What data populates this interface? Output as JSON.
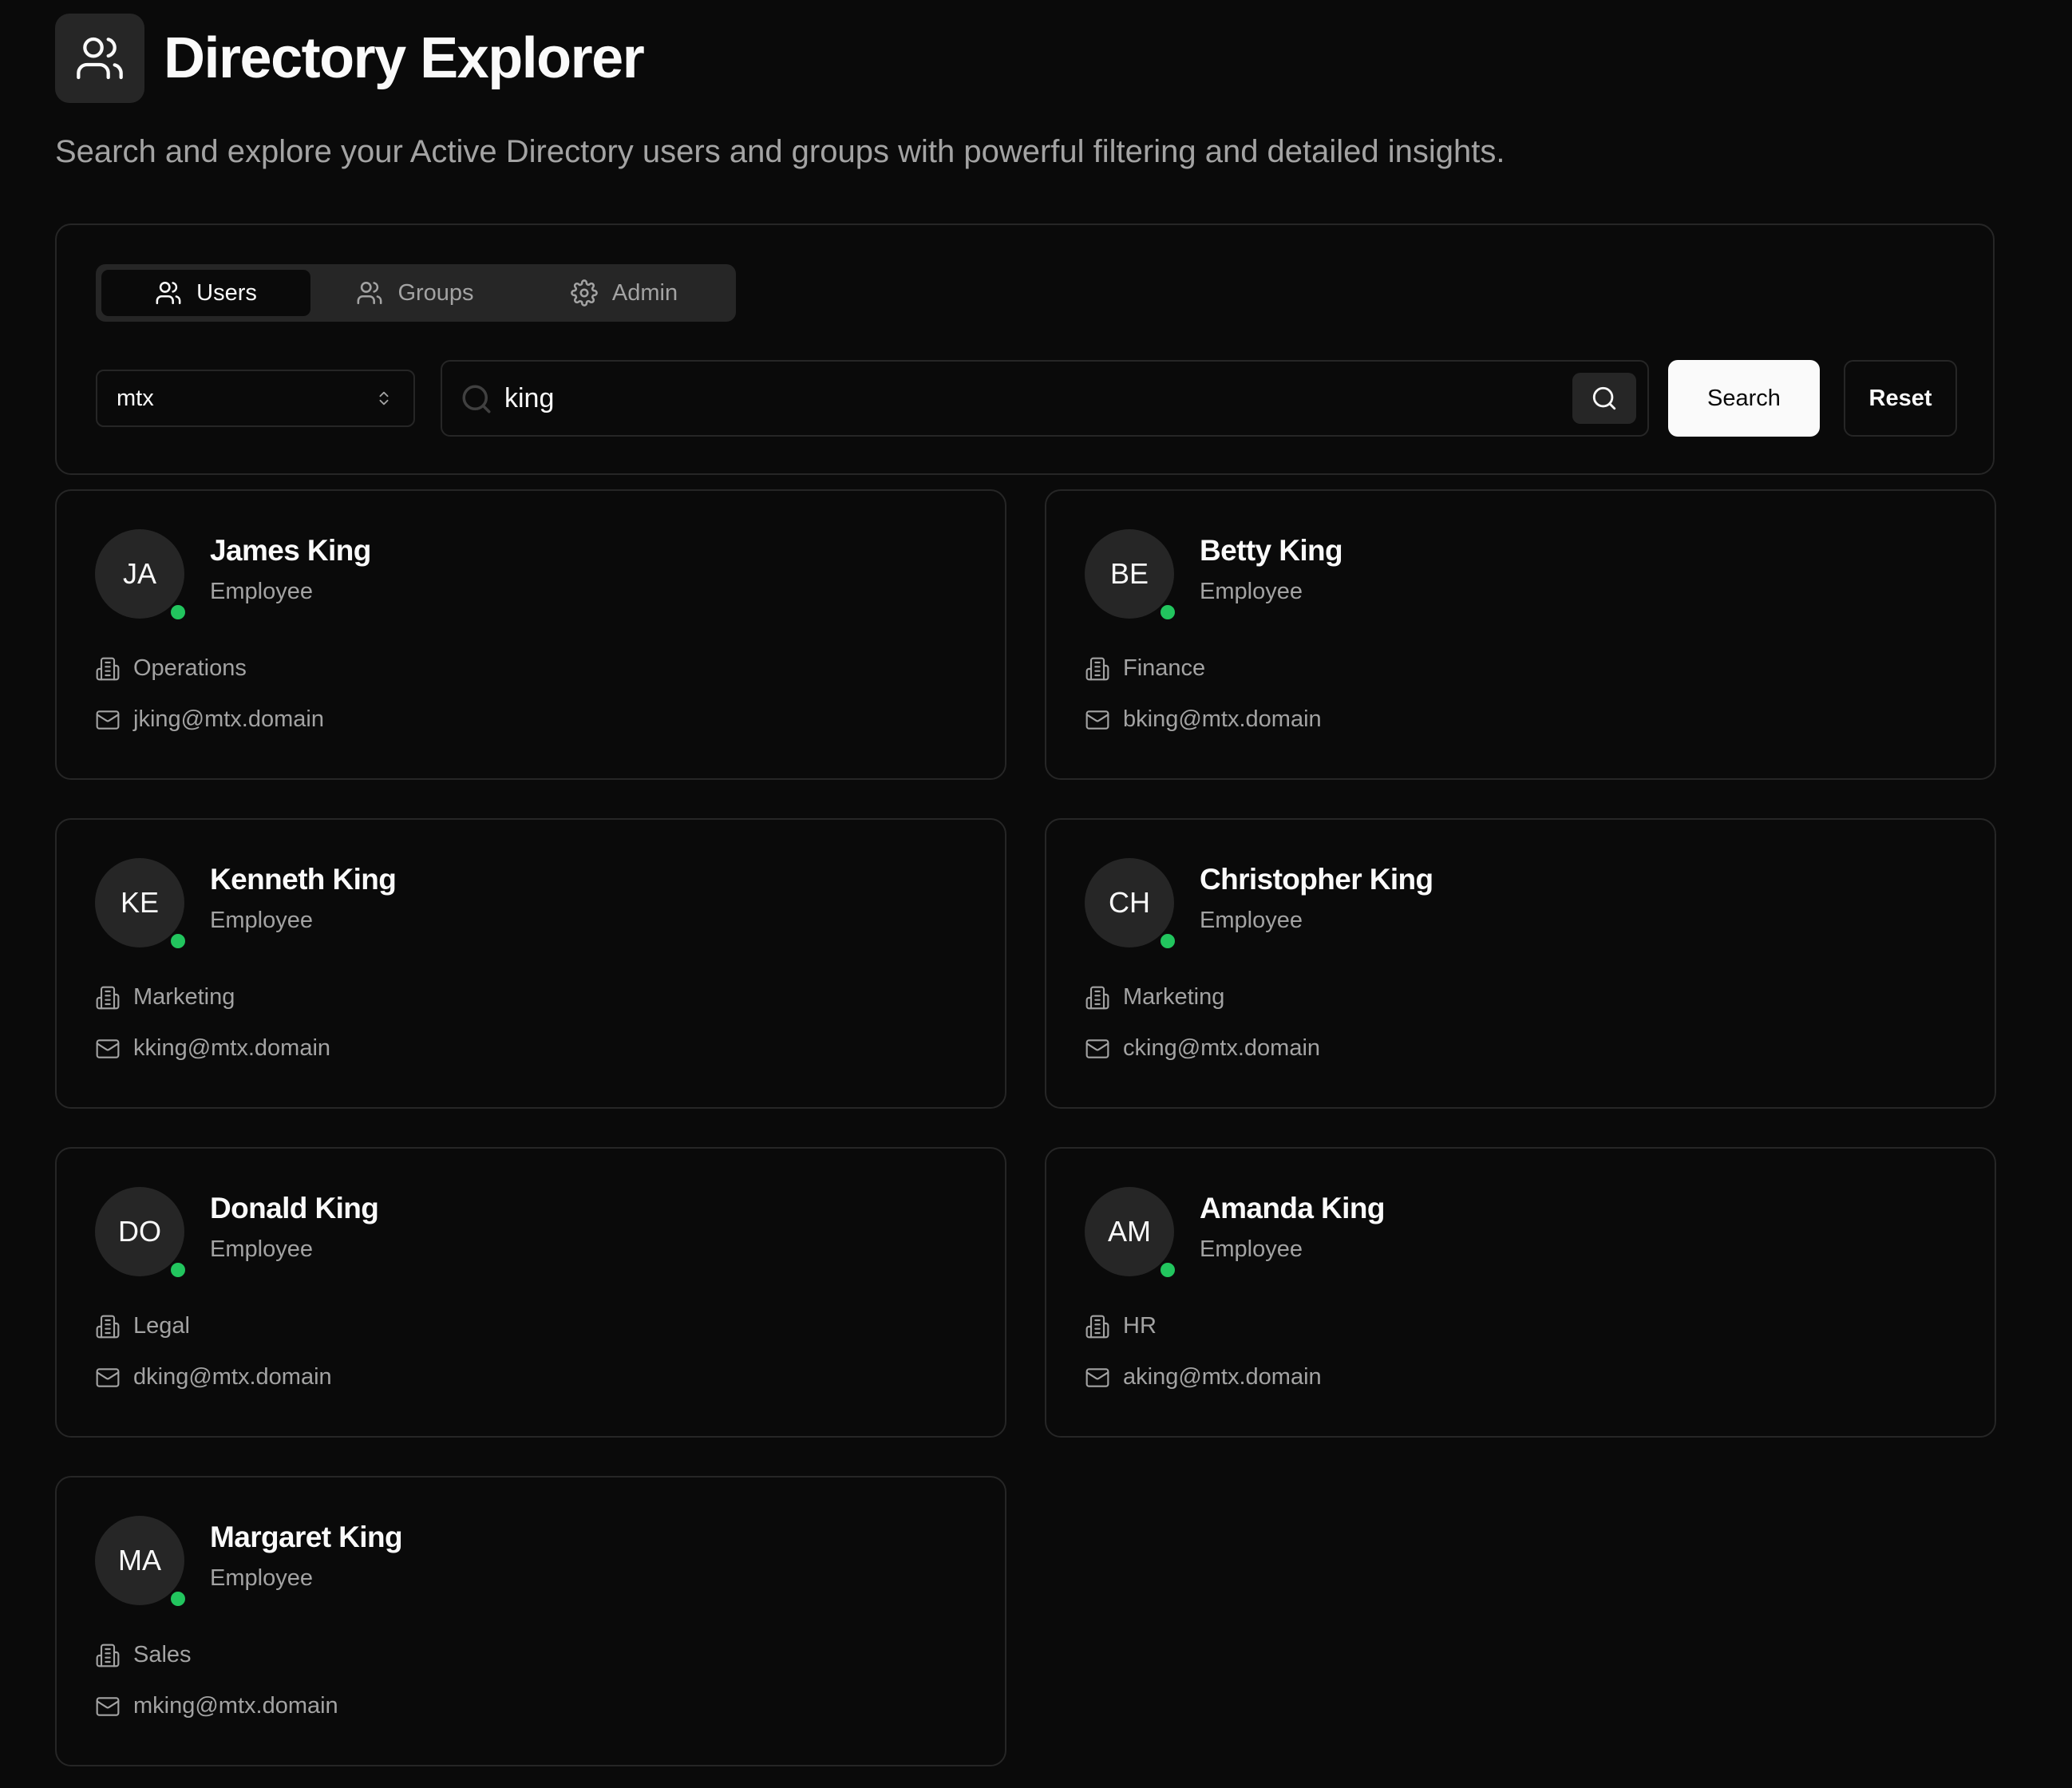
{
  "header": {
    "title": "Directory Explorer",
    "subtitle": "Search and explore your Active Directory users and groups with powerful filtering and detailed insights.",
    "icon": "users-icon"
  },
  "tabs": [
    {
      "label": "Users",
      "icon": "users-icon",
      "active": true
    },
    {
      "label": "Groups",
      "icon": "users-icon",
      "active": false
    },
    {
      "label": "Admin",
      "icon": "gear-icon",
      "active": false
    }
  ],
  "filters": {
    "domain_value": "mtx",
    "search_value": "king",
    "search_button_label": "Search",
    "reset_button_label": "Reset"
  },
  "colors": {
    "background": "#0a0a0a",
    "surface": "#262626",
    "text": "#fafafa",
    "muted_text": "#a3a3a3",
    "online_status": "#22c55e"
  },
  "users": [
    {
      "initials": "JA",
      "name": "James King",
      "title": "Employee",
      "department": "Operations",
      "email": "jking@mtx.domain",
      "online": true
    },
    {
      "initials": "BE",
      "name": "Betty King",
      "title": "Employee",
      "department": "Finance",
      "email": "bking@mtx.domain",
      "online": true
    },
    {
      "initials": "KE",
      "name": "Kenneth King",
      "title": "Employee",
      "department": "Marketing",
      "email": "kking@mtx.domain",
      "online": true
    },
    {
      "initials": "CH",
      "name": "Christopher King",
      "title": "Employee",
      "department": "Marketing",
      "email": "cking@mtx.domain",
      "online": true
    },
    {
      "initials": "DO",
      "name": "Donald King",
      "title": "Employee",
      "department": "Legal",
      "email": "dking@mtx.domain",
      "online": true
    },
    {
      "initials": "AM",
      "name": "Amanda King",
      "title": "Employee",
      "department": "HR",
      "email": "aking@mtx.domain",
      "online": true
    },
    {
      "initials": "MA",
      "name": "Margaret King",
      "title": "Employee",
      "department": "Sales",
      "email": "mking@mtx.domain",
      "online": true
    }
  ]
}
